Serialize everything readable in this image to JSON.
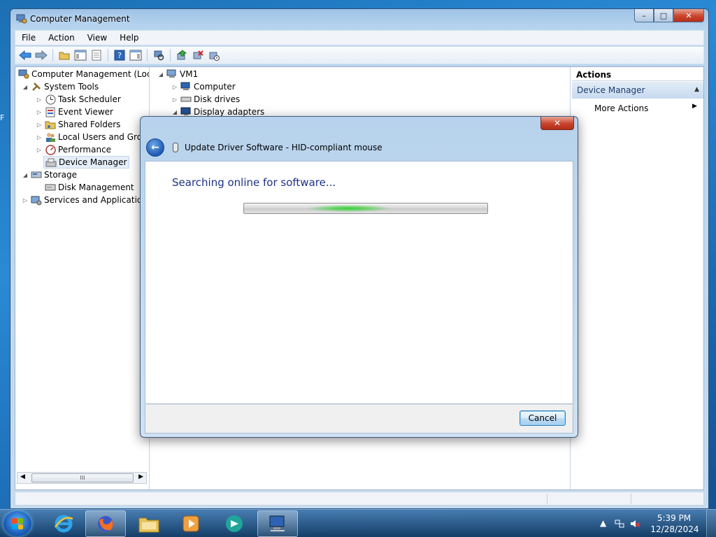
{
  "window": {
    "title": "Computer Management",
    "controls": {
      "minimize": "–",
      "maximize": "□",
      "close": "✕"
    }
  },
  "menu": [
    "File",
    "Action",
    "View",
    "Help"
  ],
  "tree": [
    {
      "label": "Computer Management (Local",
      "icon": "computer-management-icon"
    },
    {
      "label": "System Tools",
      "icon": "tools-icon"
    },
    {
      "label": "Task Scheduler",
      "icon": "clock-icon"
    },
    {
      "label": "Event Viewer",
      "icon": "event-viewer-icon"
    },
    {
      "label": "Shared Folders",
      "icon": "shared-folder-icon"
    },
    {
      "label": "Local Users and Group",
      "icon": "users-icon"
    },
    {
      "label": "Performance",
      "icon": "performance-icon"
    },
    {
      "label": "Device Manager",
      "icon": "device-manager-icon"
    },
    {
      "label": "Storage",
      "icon": "storage-icon"
    },
    {
      "label": "Disk Management",
      "icon": "disk-icon"
    },
    {
      "label": "Services and Applications",
      "icon": "services-icon"
    }
  ],
  "devices": {
    "root": "VM1",
    "items": [
      "Computer",
      "Disk drives",
      "Display adapters"
    ]
  },
  "actions": {
    "header": "Actions",
    "section": "Device Manager",
    "more": "More Actions"
  },
  "dialog": {
    "title": "Update Driver Software - HID-compliant mouse",
    "close": "✕",
    "heading": "Searching online for software...",
    "cancel": "Cancel"
  },
  "taskbar": {
    "time": "5:39 PM",
    "date": "12/28/2024"
  }
}
